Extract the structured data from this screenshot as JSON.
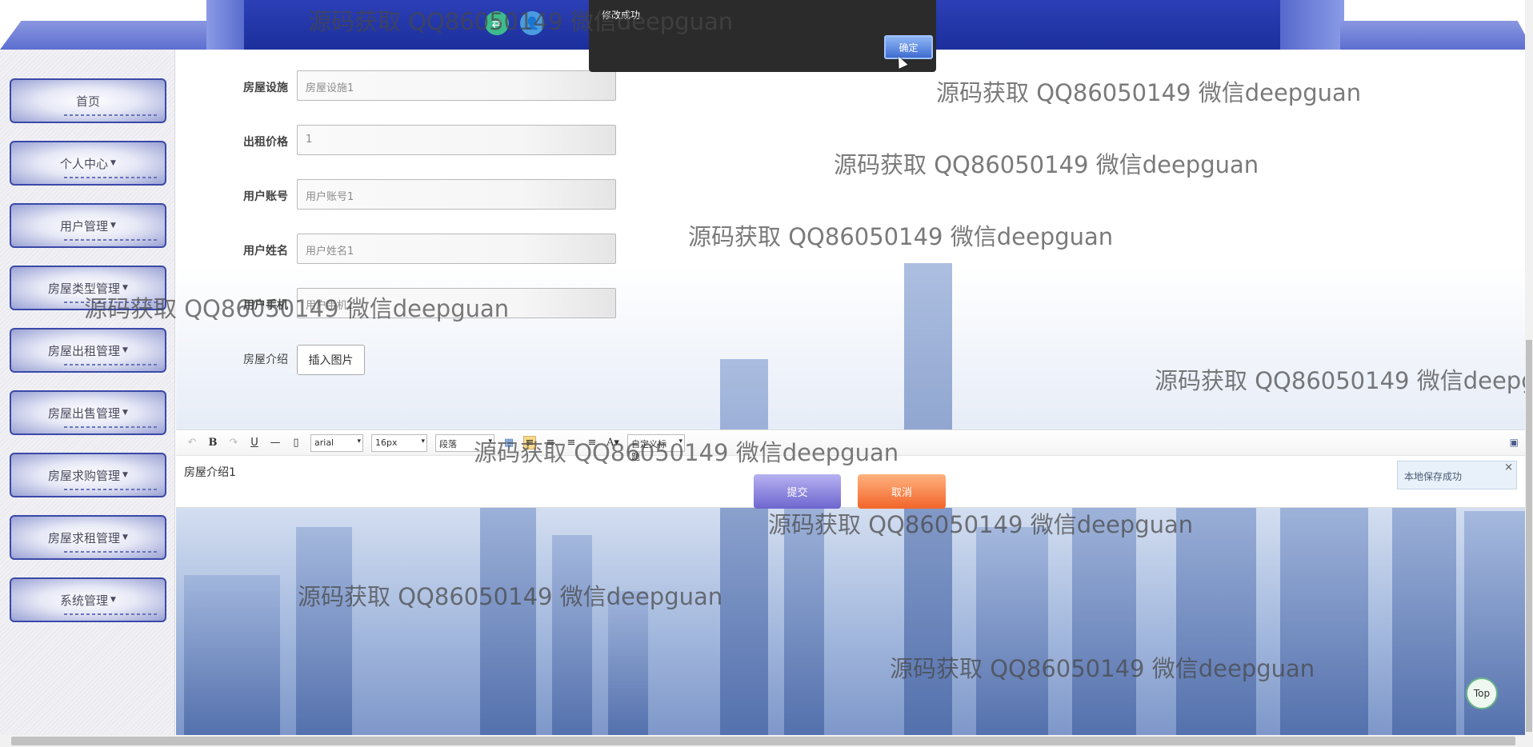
{
  "header": {
    "icons": [
      "swap-icon",
      "user-icon"
    ]
  },
  "sidebar": {
    "items": [
      {
        "label": "首页",
        "caret": false
      },
      {
        "label": "个人中心",
        "caret": true
      },
      {
        "label": "用户管理",
        "caret": true
      },
      {
        "label": "房屋类型管理",
        "caret": true
      },
      {
        "label": "房屋出租管理",
        "caret": true
      },
      {
        "label": "房屋出售管理",
        "caret": true
      },
      {
        "label": "房屋求购管理",
        "caret": true
      },
      {
        "label": "房屋求租管理",
        "caret": true
      },
      {
        "label": "系统管理",
        "caret": true
      }
    ]
  },
  "form": {
    "fields": [
      {
        "label": "房屋设施",
        "value": "房屋设施1"
      },
      {
        "label": "出租价格",
        "value": "1"
      },
      {
        "label": "用户账号",
        "value": "用户账号1"
      },
      {
        "label": "用户姓名",
        "value": "用户姓名1"
      },
      {
        "label": "用户手机",
        "value": "用户手机1"
      }
    ],
    "intro_label": "房屋介绍",
    "insert_image": "插入图片",
    "submit": "提交",
    "cancel": "取消"
  },
  "editor": {
    "font": "arial",
    "size": "16px",
    "paragraph": "段落",
    "custom_title": "自定义标题",
    "content": "房屋介绍1",
    "local_save": "本地保存成功"
  },
  "dialog": {
    "message": "修改成功",
    "ok": "确定"
  },
  "top_button": "Top",
  "watermark": "源码获取 QQ86050149 微信deepguan"
}
